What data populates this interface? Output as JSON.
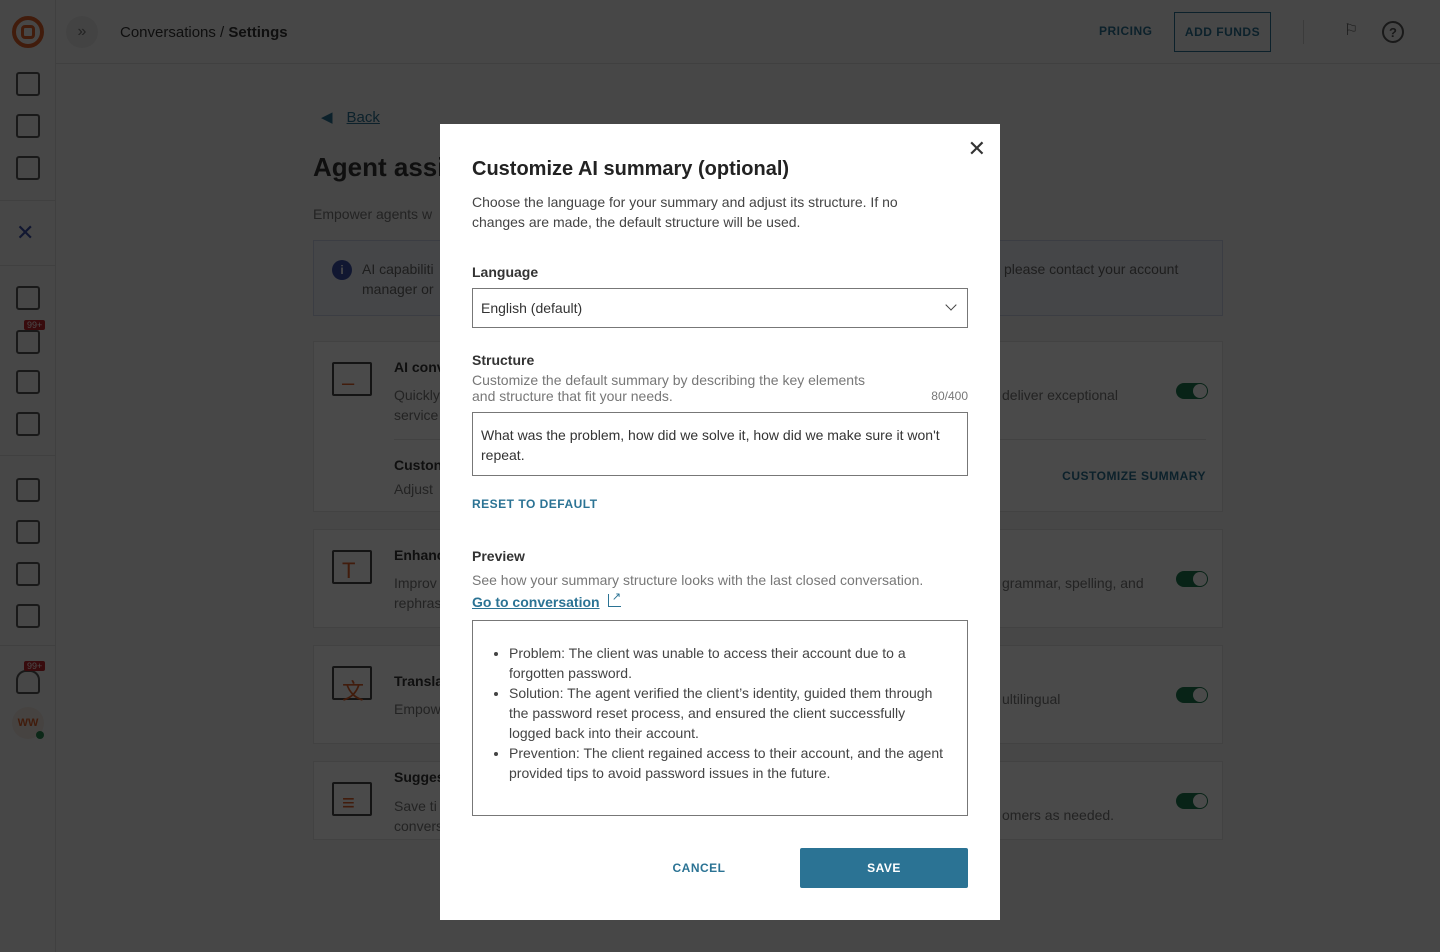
{
  "sidebar": {
    "badges": [
      "99+",
      "99+"
    ],
    "avatar_initials": "WW"
  },
  "topbar": {
    "breadcrumb_parent": "Conversations",
    "breadcrumb_sep": " / ",
    "breadcrumb_current": "Settings",
    "pricing": "PRICING",
    "add_funds": "ADD FUNDS"
  },
  "page": {
    "back": "Back",
    "title": "Agent assi",
    "subtitle": "Empower agents w",
    "info_left": [
      "AI capabiliti",
      "manager or"
    ],
    "info_right": "please contact your account",
    "cards": [
      {
        "title": "AI conv",
        "desc": "Quickly service",
        "desc_right": "deliver exceptional",
        "enabled": true,
        "sub_title": "Custon",
        "sub_desc": "Adjust",
        "action": "CUSTOMIZE SUMMARY"
      },
      {
        "title": "Enhanc",
        "desc": "Improv rephras",
        "desc_right": "grammar, spelling, and",
        "enabled": true
      },
      {
        "title": "Transla",
        "desc": "Empow",
        "desc_right": "ultilingual",
        "enabled": true
      },
      {
        "title": "Sugges",
        "desc": "Save ti convers",
        "desc_right": "omers as needed.",
        "enabled": true
      }
    ]
  },
  "modal": {
    "title": "Customize AI summary (optional)",
    "description": "Choose the language for your summary and adjust its structure. If no changes are made, the default structure will be used.",
    "language_label": "Language",
    "language_value": "English (default)",
    "structure_label": "Structure",
    "structure_hint_1": "Customize the default summary by describing the key elements",
    "structure_hint_2": "and structure that fit your needs.",
    "counter": "80/400",
    "structure_value": "What was the problem, how did we solve it, how did we make sure it won't repeat.",
    "reset": "RESET TO DEFAULT",
    "preview_label": "Preview",
    "preview_hint": "See how your summary structure looks with the last closed conversation.",
    "go_to_conversation": "Go to conversation",
    "preview_items": [
      "Problem: The client was unable to access their account due to a forgotten password.",
      "Solution: The agent verified the client’s identity, guided them through the password reset process, and ensured the client successfully logged back into their account.",
      "Prevention: The client regained access to their account, and the agent provided tips to avoid password issues in the future."
    ],
    "cancel": "CANCEL",
    "save": "SAVE"
  },
  "colors": {
    "accent": "#2b7394",
    "brand": "#e0622a",
    "toggle_on": "#1d7a4e",
    "badge": "#c0262d"
  }
}
